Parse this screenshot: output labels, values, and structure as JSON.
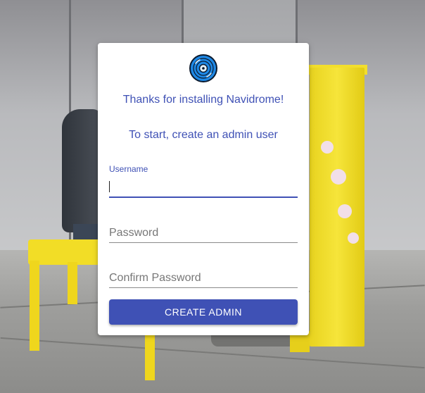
{
  "card": {
    "logo_icon": "vinyl-disc-icon",
    "welcome_text": "Thanks for installing Navidrome!",
    "instruction_text": "To start, create an admin user"
  },
  "form": {
    "username": {
      "label": "Username",
      "value": ""
    },
    "password": {
      "placeholder": "Password",
      "value": ""
    },
    "confirm_password": {
      "placeholder": "Confirm Password",
      "value": ""
    },
    "submit_label": "CREATE ADMIN"
  },
  "colors": {
    "accent": "#3f51b5",
    "logo_blue": "#1e88e5",
    "card_bg": "#ffffff"
  }
}
